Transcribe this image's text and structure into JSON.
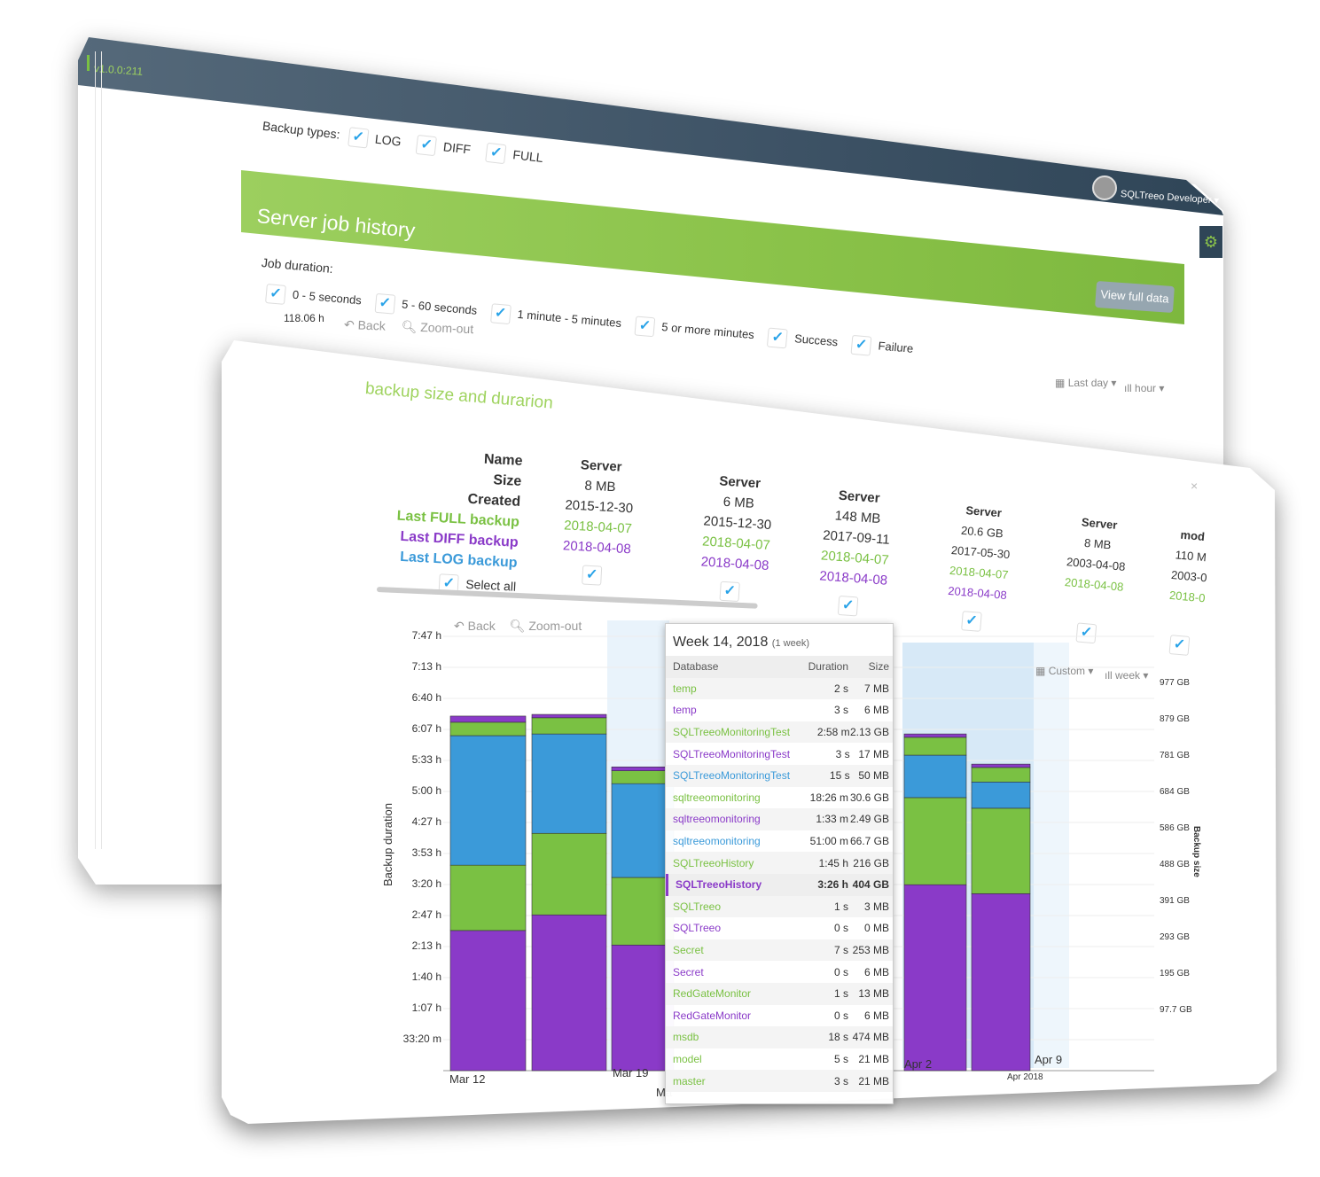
{
  "app": {
    "version": "v1.0.0:211",
    "user": "SQLTreeo Developer"
  },
  "back": {
    "backup_types_label": "Backup types:",
    "backup_types": [
      {
        "label": "LOG",
        "checked": true
      },
      {
        "label": "DIFF",
        "checked": true
      },
      {
        "label": "FULL",
        "checked": true
      }
    ],
    "section_title": "Server job history",
    "view_full_data": "View full data",
    "job_duration_label": "Job duration:",
    "filters": [
      {
        "label": "0 - 5 seconds",
        "checked": true
      },
      {
        "label": "5 - 60 seconds",
        "checked": true
      },
      {
        "label": "1 minute - 5 minutes",
        "checked": true
      },
      {
        "label": "5 or more minutes",
        "checked": true
      },
      {
        "label": "Success",
        "checked": true
      },
      {
        "label": "Failure",
        "checked": true
      }
    ],
    "axis_top": "118.06 h",
    "back": "Back",
    "zoom_out": "Zoom-out",
    "range": "Last day",
    "interval": "hour"
  },
  "front": {
    "title": "backup size and durarion",
    "close": "×",
    "row_labels": {
      "name": "Name",
      "size": "Size",
      "created": "Created",
      "full": "Last FULL backup",
      "diff": "Last DIFF backup",
      "log": "Last LOG backup",
      "select_all": "Select all"
    },
    "columns": [
      {
        "name": "Server",
        "size": "8 MB",
        "created": "2015-12-30",
        "full": "2018-04-07",
        "diff": "2018-04-08",
        "checked": true
      },
      {
        "name": "Server",
        "size": "6 MB",
        "created": "2015-12-30",
        "full": "2018-04-07",
        "diff": "2018-04-08",
        "checked": true
      },
      {
        "name": "Server",
        "size": "148 MB",
        "created": "2017-09-11",
        "full": "2018-04-07",
        "diff": "2018-04-08",
        "checked": true
      },
      {
        "name": "Server",
        "size": "20.6 GB",
        "created": "2017-05-30",
        "full": "2018-04-07",
        "diff": "2018-04-08",
        "checked": true
      },
      {
        "name": "Server",
        "size": "8 MB",
        "created": "2003-04-08",
        "full": "2018-04-08",
        "diff": "",
        "checked": true
      },
      {
        "name": "mod",
        "size": "110 M",
        "created": "2003-0",
        "full": "2018-0",
        "diff": "",
        "checked": true
      }
    ],
    "back": "Back",
    "zoom_out": "Zoom-out",
    "range": "Custom",
    "interval": "week",
    "colors": {
      "full": "#7ac143",
      "diff": "#8a3ac8",
      "log": "#3b9ad9"
    }
  },
  "tooltip": {
    "title": "Week 14, 2018",
    "subtitle": "(1 week)",
    "headers": {
      "database": "Database",
      "duration": "Duration",
      "size": "Size"
    },
    "rows": [
      {
        "db": "temp",
        "duration": "2 s",
        "size": "7 MB",
        "type": "full"
      },
      {
        "db": "temp",
        "duration": "3 s",
        "size": "6 MB",
        "type": "diff"
      },
      {
        "db": "SQLTreeoMonitoringTest",
        "duration": "2:58 m",
        "size": "2.13 GB",
        "type": "full"
      },
      {
        "db": "SQLTreeoMonitoringTest",
        "duration": "3 s",
        "size": "17 MB",
        "type": "diff"
      },
      {
        "db": "SQLTreeoMonitoringTest",
        "duration": "15 s",
        "size": "50 MB",
        "type": "log"
      },
      {
        "db": "sqltreeomonitoring",
        "duration": "18:26 m",
        "size": "30.6 GB",
        "type": "full"
      },
      {
        "db": "sqltreeomonitoring",
        "duration": "1:33 m",
        "size": "2.49 GB",
        "type": "diff"
      },
      {
        "db": "sqltreeomonitoring",
        "duration": "51:00 m",
        "size": "66.7 GB",
        "type": "log"
      },
      {
        "db": "SQLTreeoHistory",
        "duration": "1:45 h",
        "size": "216 GB",
        "type": "full"
      },
      {
        "db": "SQLTreeoHistory",
        "duration": "3:26 h",
        "size": "404 GB",
        "type": "diff",
        "highlighted": true
      },
      {
        "db": "SQLTreeo",
        "duration": "1 s",
        "size": "3 MB",
        "type": "full"
      },
      {
        "db": "SQLTreeo",
        "duration": "0 s",
        "size": "0 MB",
        "type": "diff"
      },
      {
        "db": "Secret",
        "duration": "7 s",
        "size": "253 MB",
        "type": "full"
      },
      {
        "db": "Secret",
        "duration": "0 s",
        "size": "6 MB",
        "type": "diff"
      },
      {
        "db": "RedGateMonitor",
        "duration": "1 s",
        "size": "13 MB",
        "type": "full"
      },
      {
        "db": "RedGateMonitor",
        "duration": "0 s",
        "size": "6 MB",
        "type": "diff"
      },
      {
        "db": "msdb",
        "duration": "18 s",
        "size": "474 MB",
        "type": "full"
      },
      {
        "db": "model",
        "duration": "5 s",
        "size": "21 MB",
        "type": "full"
      },
      {
        "db": "master",
        "duration": "3 s",
        "size": "21 MB",
        "type": "full"
      }
    ]
  },
  "chart_data": {
    "type": "bar",
    "stacked": true,
    "ylabel": "Backup duration",
    "y2label": "Backup size",
    "y_ticks": [
      "33:20 m",
      "1:07 h",
      "1:40 h",
      "2:13 h",
      "2:47 h",
      "3:20 h",
      "3:53 h",
      "4:27 h",
      "5:00 h",
      "5:33 h",
      "6:07 h",
      "6:40 h",
      "7:13 h",
      "7:47 h"
    ],
    "y2_ticks": [
      "97.7 GB",
      "195 GB",
      "293 GB",
      "391 GB",
      "488 GB",
      "586 GB",
      "684 GB",
      "781 GB",
      "879 GB",
      "977 GB"
    ],
    "x_tick_labels": [
      "Mar 12",
      "Mar 19",
      "Ma",
      "Apr 2",
      "Apr 9"
    ],
    "x_sublabel": "Apr 2018",
    "ylim_hours": [
      0,
      7.78
    ],
    "segment_colors": [
      "#8a3ac8",
      "#7ac143",
      "#3b9ad9",
      "#7ac143",
      "#8a3ac8"
    ],
    "bars": [
      {
        "segments_hours": [
          2.51,
          1.17,
          2.32,
          0.24,
          0.11
        ]
      },
      {
        "segments_hours": [
          2.79,
          1.46,
          1.78,
          0.29,
          0.06
        ]
      },
      {
        "segments_hours": [
          2.25,
          1.21,
          1.68,
          0.23,
          0.07
        ]
      },
      {
        "segments_hours": [
          3.33,
          1.56,
          0.76,
          0.32,
          0.06
        ]
      },
      {
        "segments_hours": [
          3.17,
          1.53,
          0.47,
          0.26,
          0.06
        ]
      }
    ],
    "grid": true
  }
}
